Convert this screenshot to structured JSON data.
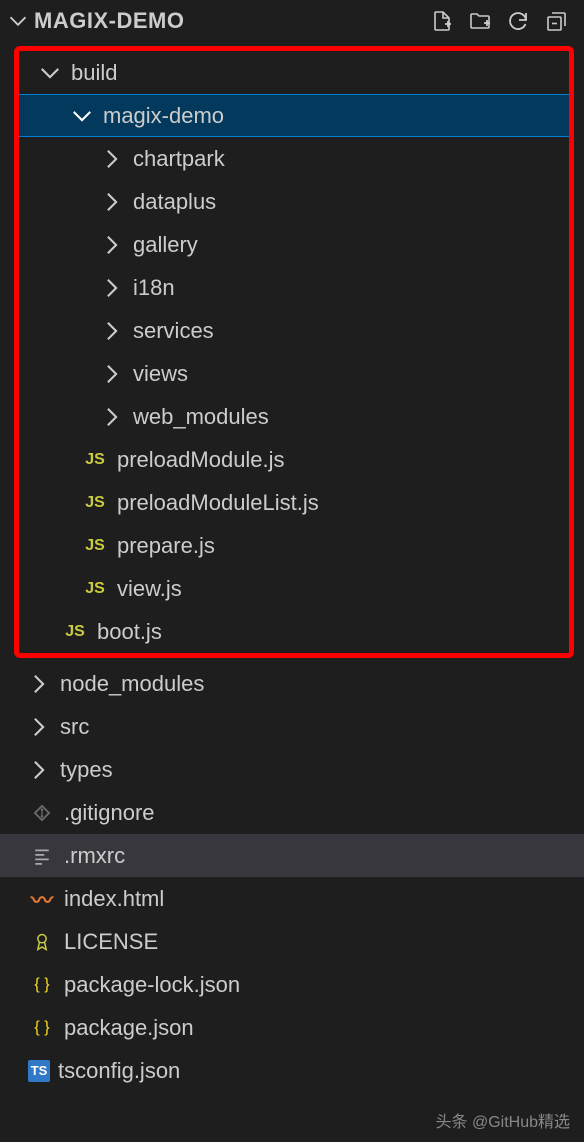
{
  "header": {
    "title": "MAGIX-DEMO"
  },
  "tree": {
    "build": {
      "label": "build",
      "expanded": true,
      "children": {
        "magix_demo": {
          "label": "magix-demo",
          "expanded": true,
          "selected": true,
          "folders": [
            "chartpark",
            "dataplus",
            "gallery",
            "i18n",
            "services",
            "views",
            "web_modules"
          ],
          "files": [
            "preloadModule.js",
            "preloadModuleList.js",
            "prepare.js",
            "view.js"
          ]
        },
        "boot": "boot.js"
      }
    },
    "root_items": [
      {
        "label": "node_modules",
        "type": "folder"
      },
      {
        "label": "src",
        "type": "folder"
      },
      {
        "label": "types",
        "type": "folder"
      },
      {
        "label": ".gitignore",
        "type": "git"
      },
      {
        "label": ".rmxrc",
        "type": "lines",
        "active": true
      },
      {
        "label": "index.html",
        "type": "html"
      },
      {
        "label": "LICENSE",
        "type": "license"
      },
      {
        "label": "package-lock.json",
        "type": "json"
      },
      {
        "label": "package.json",
        "type": "json"
      },
      {
        "label": "tsconfig.json",
        "type": "ts"
      }
    ]
  },
  "watermark": "头条 @GitHub精选"
}
